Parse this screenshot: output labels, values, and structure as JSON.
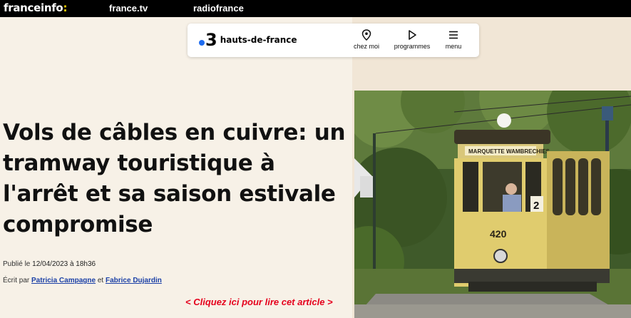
{
  "network": {
    "brand": "franceinfo",
    "brand_suffix": ":",
    "links": [
      "france.tv",
      "radiofrance"
    ]
  },
  "header": {
    "logo_number": "3",
    "logo_region": "hauts-de-france",
    "nav": [
      {
        "label": "chez moi",
        "icon": "location-pin-icon"
      },
      {
        "label": "programmes",
        "icon": "play-icon"
      },
      {
        "label": "menu",
        "icon": "hamburger-menu-icon"
      }
    ]
  },
  "article": {
    "title_lines": [
      "Vols de câbles en cuivre: un",
      "tramway touristique à",
      "l'arrêt et sa saison estivale",
      "compromise"
    ],
    "published_label": "Publié le",
    "published_value": "12/04/2023 à 18h36",
    "written_label": "Écrit par",
    "author1": "Patricia Campagne",
    "author_sep": "et",
    "author2": "Fabrice Dujardin",
    "cta": "< Cliquez ici pour lire cet article >"
  },
  "photo": {
    "sign_left": "MARQUETTE",
    "sign_right": "WAMBRECHIES",
    "side_number": "2",
    "front_number": "420"
  },
  "colors": {
    "accent_yellow": "#fdd301",
    "logo_blue": "#1e6cf0",
    "link_blue": "#1a3fa6",
    "cta_red": "#e5001c"
  }
}
